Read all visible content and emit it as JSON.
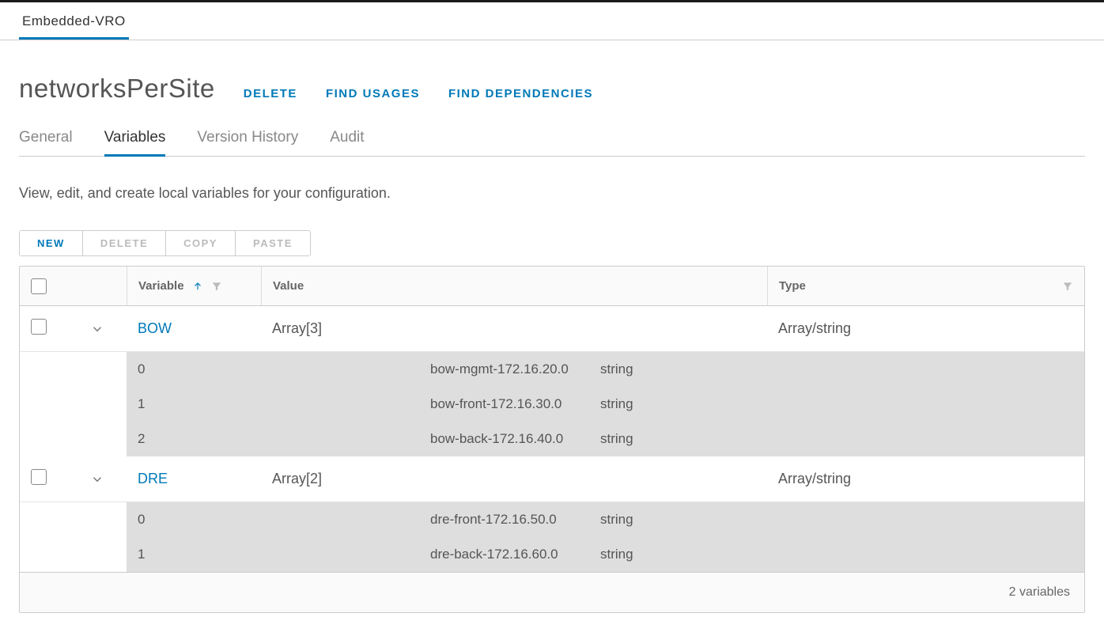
{
  "breadcrumb": "Embedded-VRO",
  "title": "networksPerSite",
  "actions": {
    "delete": "DELETE",
    "find_usages": "FIND USAGES",
    "find_deps": "FIND DEPENDENCIES"
  },
  "tabs": {
    "general": "General",
    "variables": "Variables",
    "version": "Version History",
    "audit": "Audit"
  },
  "description": "View, edit, and create local variables for your configuration.",
  "buttons": {
    "new": "NEW",
    "delete": "DELETE",
    "copy": "COPY",
    "paste": "PASTE"
  },
  "columns": {
    "variable": "Variable",
    "value": "Value",
    "type": "Type"
  },
  "rows": [
    {
      "name": "BOW",
      "value": "Array[3]",
      "type": "Array/string",
      "items": [
        {
          "idx": "0",
          "val": "bow-mgmt-172.16.20.0",
          "typ": "string"
        },
        {
          "idx": "1",
          "val": "bow-front-172.16.30.0",
          "typ": "string"
        },
        {
          "idx": "2",
          "val": "bow-back-172.16.40.0",
          "typ": "string"
        }
      ]
    },
    {
      "name": "DRE",
      "value": "Array[2]",
      "type": "Array/string",
      "items": [
        {
          "idx": "0",
          "val": "dre-front-172.16.50.0",
          "typ": "string"
        },
        {
          "idx": "1",
          "val": "dre-back-172.16.60.0",
          "typ": "string"
        }
      ]
    }
  ],
  "footer": "2 variables"
}
